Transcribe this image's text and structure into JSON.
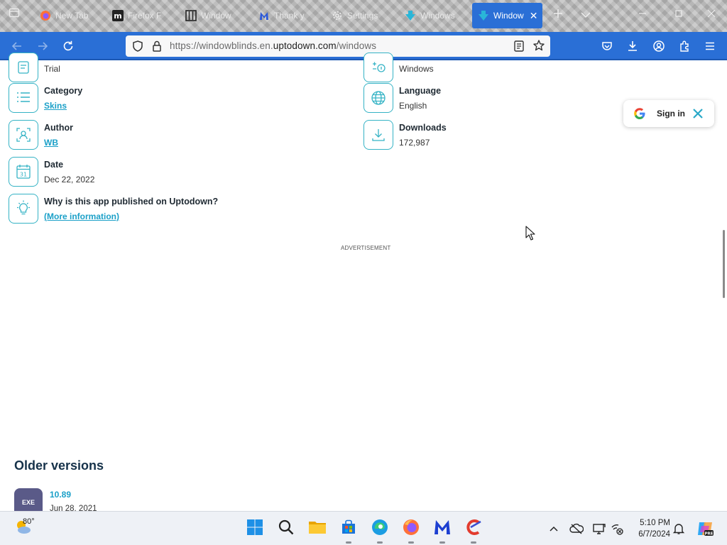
{
  "browser": {
    "tabs": [
      {
        "label": "New Tab",
        "icon": "firefox-icon"
      },
      {
        "label": "Firefox F",
        "icon": "m-logo-icon"
      },
      {
        "label": "Window",
        "icon": "windowblinds-icon"
      },
      {
        "label": "Thank y",
        "icon": "malwarebytes-icon"
      },
      {
        "label": "Settings",
        "icon": "gear-icon"
      },
      {
        "label": "Windows",
        "icon": "uptodown-icon"
      }
    ],
    "active_tab": {
      "label": "Window",
      "icon": "uptodown-icon"
    },
    "url_prefix": "https://windowblinds.en.",
    "url_domain": "uptodown.com",
    "url_path": "/windows"
  },
  "details": {
    "left": [
      {
        "label": "",
        "value": "Trial",
        "icon": "license-icon",
        "is_link": false
      },
      {
        "label": "Category",
        "value": "Skins",
        "icon": "list-icon",
        "is_link": true
      },
      {
        "label": "Author",
        "value": "WB",
        "icon": "author-icon",
        "is_link": true
      },
      {
        "label": "Date",
        "value": "Dec 22, 2022",
        "icon": "calendar-icon",
        "is_link": false
      },
      {
        "label": "Why is this app published on Uptodown?",
        "value": "(More information)",
        "icon": "lightbulb-icon",
        "is_link": true
      }
    ],
    "right": [
      {
        "label": "",
        "value": "Windows",
        "icon": "os-icon"
      },
      {
        "label": "Language",
        "value": "English",
        "icon": "globe-icon"
      },
      {
        "label": "Downloads",
        "value": "172,987",
        "icon": "download-icon"
      }
    ]
  },
  "advertisement_label": "ADVERTISEMENT",
  "google_signin": {
    "label": "Sign in"
  },
  "older_versions": {
    "title": "Older versions",
    "items": [
      {
        "badge": "EXE",
        "version": "10.89",
        "date": "Jun 28, 2021"
      }
    ]
  },
  "taskbar": {
    "weather_temp": "80°",
    "time": "5:10 PM",
    "date": "6/7/2024"
  },
  "colors": {
    "accent": "#2a6fd6",
    "teal": "#35b3c5",
    "link": "#1ba0c8"
  }
}
